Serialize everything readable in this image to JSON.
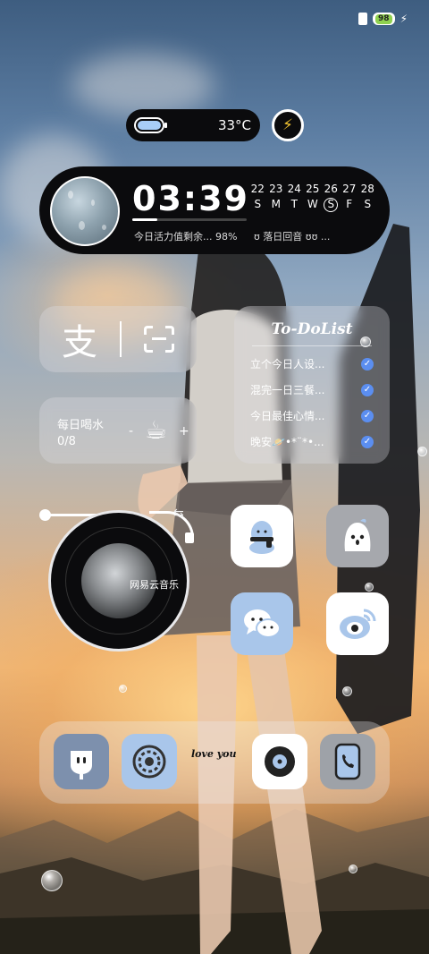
{
  "status_bar": {
    "battery_level": "98"
  },
  "battery_island": {
    "temperature": "33°C"
  },
  "clock_widget": {
    "time": "03:39",
    "days": [
      "22",
      "23",
      "24",
      "25",
      "26",
      "27",
      "28"
    ],
    "weekdays": [
      "S",
      "M",
      "T",
      "W",
      "S",
      "F",
      "S"
    ],
    "activity_text": "今日活力值剩余... 98%",
    "music_icon": "ʊ",
    "music_text": "落日回音 ʊʊ ..."
  },
  "alipay": {
    "logo_char": "支"
  },
  "water": {
    "title": "每日喝水",
    "count": "0/8",
    "minus": "-",
    "plus": "+"
  },
  "todo": {
    "title": "To-DoList",
    "items": [
      "立个今日人设...",
      "混完一日三餐...",
      "今日最佳心情...",
      "晚安🪐•*¨*•..."
    ]
  },
  "music": {
    "app_label": "网易云音乐"
  },
  "dock": {
    "tagline": "love you"
  },
  "colors": {
    "accent_blue": "#a8cdf8",
    "icon_blue": "#a9c6ea",
    "check_blue": "#5b8ef0",
    "dark": "#0b0b0d",
    "bolt_yellow": "#f4c531"
  }
}
